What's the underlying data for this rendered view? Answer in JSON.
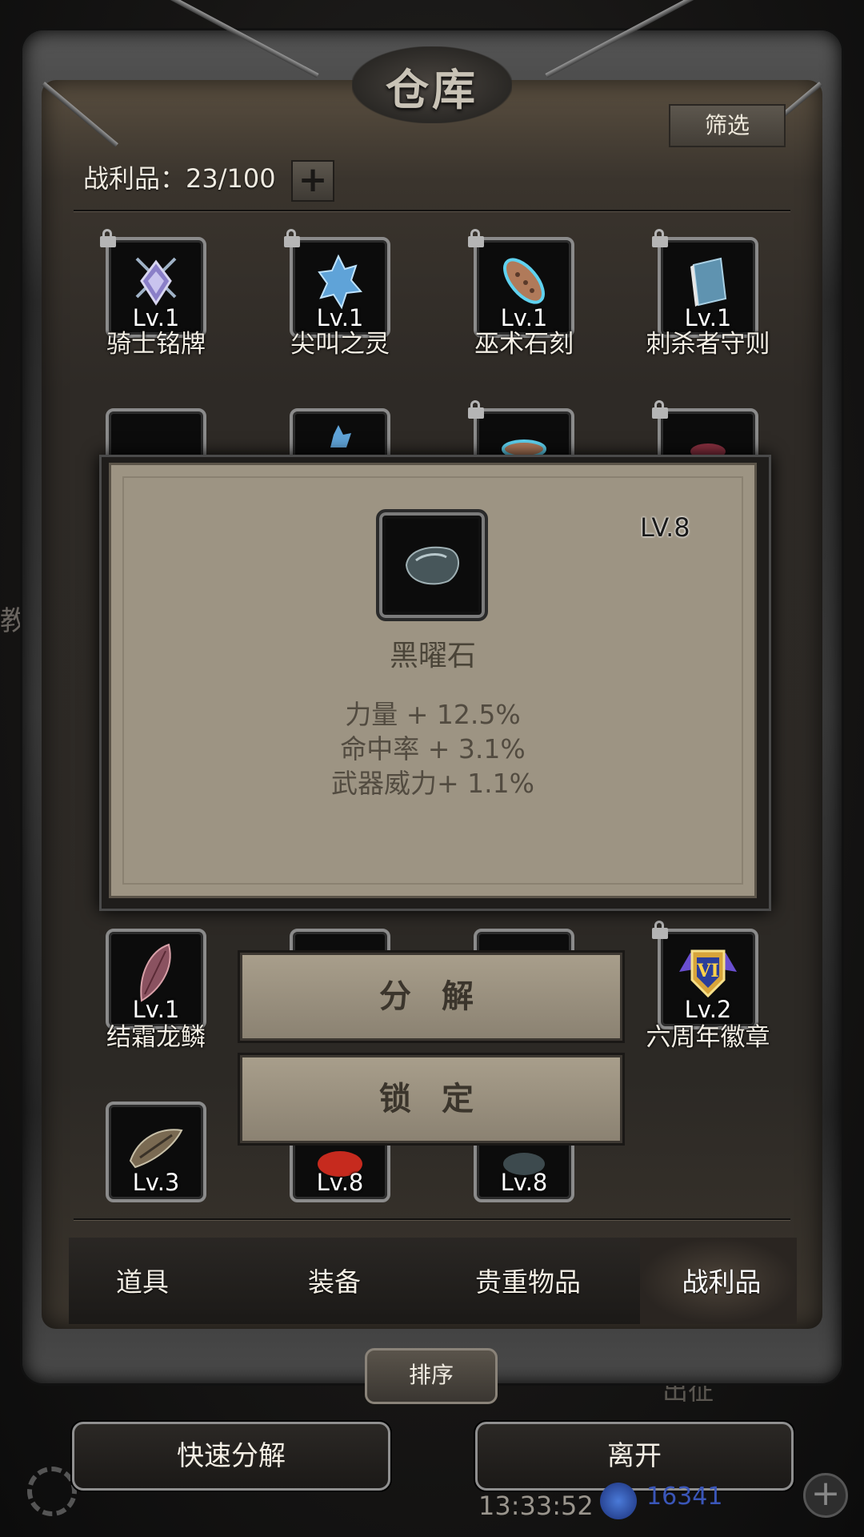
{
  "window": {
    "title": "仓库",
    "filter_label": "筛选"
  },
  "inventory": {
    "count_label": "战利品：23/100",
    "add_icon": "plus-icon"
  },
  "items": [
    {
      "name": "骑士铭牌",
      "level": "Lv.1",
      "locked": true,
      "icon": "knight-emblem-icon"
    },
    {
      "name": "尖叫之灵",
      "level": "Lv.1",
      "locked": true,
      "icon": "spirit-crystal-icon"
    },
    {
      "name": "巫术石刻",
      "level": "Lv.1",
      "locked": true,
      "icon": "rune-stone-icon"
    },
    {
      "name": "刺杀者守则",
      "level": "Lv.1",
      "locked": true,
      "icon": "book-icon"
    }
  ],
  "popup": {
    "level": "LV.8",
    "name": "黑曜石",
    "icon": "obsidian-icon",
    "stats": [
      "力量 + 12.5%",
      "命中率 + 3.1%",
      "武器威力+ 1.1%"
    ]
  },
  "row_bottom": [
    {
      "name": "结霜龙鳞",
      "level": "Lv.1",
      "icon": "dragon-scale-icon",
      "locked": false
    },
    {
      "name": "六周年徽章",
      "level": "Lv.2",
      "icon": "anniversary-badge-icon",
      "locked": true
    }
  ],
  "row_last": [
    {
      "level": "Lv.3",
      "icon": "iron-shard-icon"
    },
    {
      "level": "Lv.8",
      "icon": "holy-stone-icon"
    },
    {
      "level": "Lv.8",
      "icon": "obsidian-icon"
    }
  ],
  "actions": {
    "decompose": "分 解",
    "lock": "锁 定"
  },
  "tabs": [
    {
      "label": "道具",
      "active": false
    },
    {
      "label": "装备",
      "active": false
    },
    {
      "label": "贵重物品",
      "active": false
    },
    {
      "label": "战利品",
      "active": true
    }
  ],
  "sort_label": "排序",
  "bottom_buttons": {
    "quick_decompose": "快速分解",
    "leave": "离开"
  },
  "background": {
    "left_text": "教",
    "right_text": "出征",
    "time": "13:33:52",
    "currency": "16341"
  },
  "colors": {
    "panel_bg": "#2c2925",
    "popup_bg": "#9d9483",
    "accent_text": "#f3eee4"
  }
}
